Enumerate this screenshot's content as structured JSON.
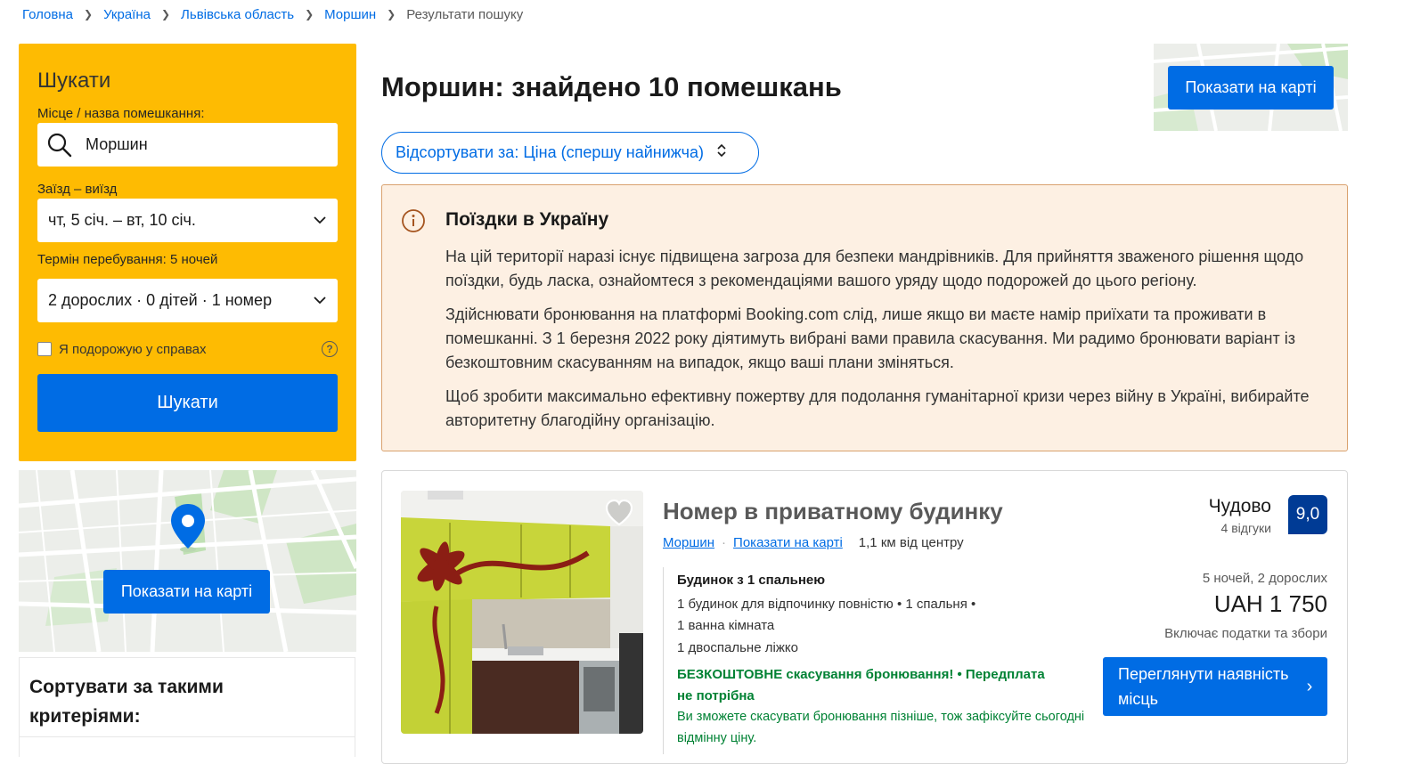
{
  "breadcrumb": {
    "items": [
      "Головна",
      "Україна",
      "Львівська область",
      "Моршин"
    ],
    "current": "Результати пошуку"
  },
  "search": {
    "title": "Шукати",
    "destination_label": "Місце / назва помешкання:",
    "destination_value": "Моршин",
    "dates_label": "Заїзд – виїзд",
    "dates_value": "чт, 5 січ. – вт, 10 січ.",
    "stay_length": "Термін перебування: 5 ночей",
    "guests_value": "2 дорослих · 0 дітей · 1 номер",
    "business_label": "Я подорожую у справах",
    "submit_label": "Шукати"
  },
  "map": {
    "sidebar_button": "Показати на карті",
    "top_button": "Показати на карті"
  },
  "sort_panel": {
    "title": "Сортувати за такими критеріями:"
  },
  "results": {
    "title": "Моршин: знайдено 10 помешкань",
    "sort_label": "Відсортувати за: Ціна (спершу найнижча)"
  },
  "alert": {
    "title": "Поїздки в Україну",
    "p1": "На цій території наразі існує підвищена загроза для безпеки мандрівників. Для прийняття зваженого рішення щодо поїздки, будь ласка, ознайомтеся з рекомендаціями вашого уряду щодо подорожей до цього регіону.",
    "p2": "Здійснювати бронювання на платформі Booking.com слід, лише якщо ви маєте намір приїхати та проживати в помешканні. З 1 березня 2022 року діятимуть вибрані вами правила скасування. Ми радимо бронювати варіант із безкоштовним скасуванням на випадок, якщо ваші плани зміняться.",
    "p3": "Щоб зробити максимально ефективну пожертву для подолання гуманітарної кризи через війну в Україні, вибирайте авторитетну благодійну організацію."
  },
  "property": {
    "name": "Номер в приватному будинку",
    "city_link": "Моршин",
    "map_link": "Показати на карті",
    "distance": "1,1 км від центру",
    "room_type": "Будинок з 1 спальнею",
    "room_desc1": "1 будинок для відпочинку повністю • 1 спальня •",
    "room_desc2": "1 ванна кімната",
    "room_desc3": "1 двоспальне ліжко",
    "free_cancel_line1": "БЕЗКОШТОВНЕ скасування бронювання! • Передплата",
    "free_cancel_line2": "не потрібна",
    "cancel_note": "Ви зможете скасувати бронювання пізніше, тож зафіксуйте сьогодні відмінну ціну.",
    "rating_word": "Чудово",
    "reviews": "4 відгуки",
    "score": "9,0",
    "stay": "5 ночей, 2 дорослих",
    "price": "UAH 1 750",
    "taxes": "Включає податки та збори",
    "cta": "Переглянути наявність місць"
  },
  "icons": {
    "search": "search-icon",
    "chevron": "chevron-down-icon",
    "help": "question-icon",
    "info": "info-icon",
    "heart": "heart-icon",
    "pin": "map-pin-icon"
  },
  "colors": {
    "primary": "#006ce4",
    "search_bg": "#febb02",
    "score_bg": "#003b95",
    "alert_bg": "#fdf0e3",
    "green": "#008234"
  }
}
